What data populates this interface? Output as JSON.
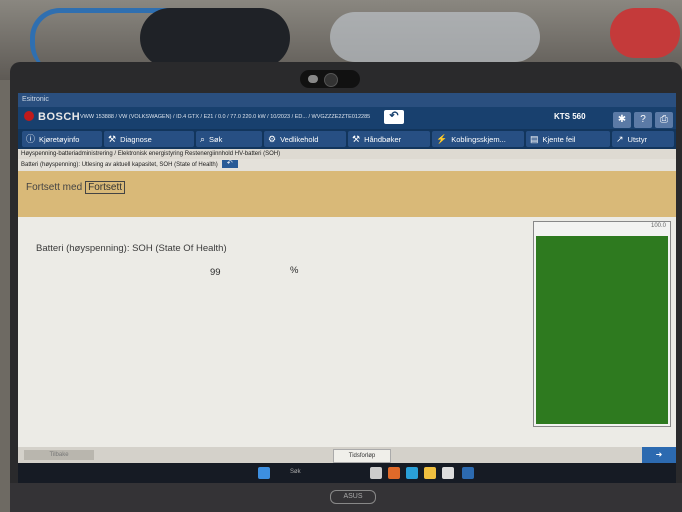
{
  "window": {
    "title": "Esitronic"
  },
  "header": {
    "brand": "BOSCH",
    "vehicle": "VWW 153888 / VW (VOLKSWAGEN) / ID.4 GTX / E21 / 0.0 / 77.0 220.0 kW / 10/2023 / ED... / WVGZZZE2ZTE012285",
    "device": "KTS 560",
    "back_icon": "back-arrow-icon"
  },
  "tabs": [
    {
      "label": "Kjøretøyinfo",
      "icon": "info-icon"
    },
    {
      "label": "Diagnose",
      "icon": "wrench-icon"
    },
    {
      "label": "Søk",
      "icon": "search-icon"
    },
    {
      "label": "Vedlikehold",
      "icon": "gears-icon"
    },
    {
      "label": "Håndbøker",
      "icon": "wrench-icon"
    },
    {
      "label": "Koblingsskjem...",
      "icon": "bolt-icon"
    },
    {
      "label": "Kjente feil",
      "icon": "book-icon"
    },
    {
      "label": "Utstyr",
      "icon": "arrow-icon"
    }
  ],
  "breadcrumb": "Høyspenning-batteriadministrering / Elektronisk energistyring Restenergiinnhold HV-batteri (SOH)",
  "subtitle": "Batteri (høyspenning): Utlesing av aktuell kapasitet, SOH (State of Health)",
  "banner": {
    "text": "Fortsett med",
    "button": "Fortsett"
  },
  "reading": {
    "label": "Batteri (høyspenning): SOH (State Of Health)",
    "value": "99",
    "unit": "%",
    "gauge_max": "100.0",
    "gauge_fraction": 0.99
  },
  "statusbar": {
    "left": "Tilbake",
    "middle": "Tidsforløp"
  },
  "taskbar": {
    "search": "Søk"
  },
  "laptop": {
    "brand": "ASUS"
  }
}
